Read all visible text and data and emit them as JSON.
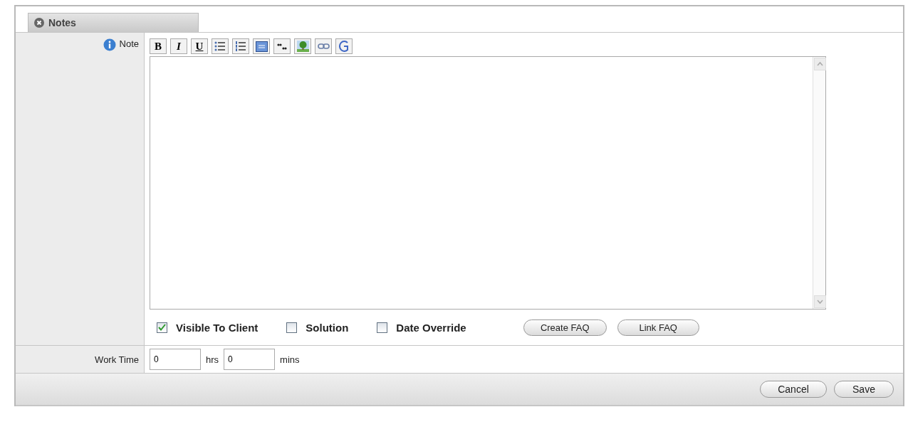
{
  "tab": {
    "title": "Notes"
  },
  "note": {
    "label": "Note",
    "toolbar": [
      {
        "kind": "bold",
        "label": "B"
      },
      {
        "kind": "italic",
        "label": "I"
      },
      {
        "kind": "underline",
        "label": "U"
      },
      {
        "kind": "bullets"
      },
      {
        "kind": "numbers"
      },
      {
        "kind": "block"
      },
      {
        "kind": "quote"
      },
      {
        "kind": "image"
      },
      {
        "kind": "link"
      },
      {
        "kind": "google"
      }
    ],
    "options": [
      {
        "label": "Visible To Client",
        "checked": true
      },
      {
        "label": "Solution",
        "checked": false
      },
      {
        "label": "Date Override",
        "checked": false
      }
    ],
    "buttons": [
      "Create FAQ",
      "Link FAQ"
    ]
  },
  "work_time": {
    "label": "Work Time",
    "hours": "0",
    "hours_unit": "hrs",
    "minutes": "0",
    "minutes_unit": "mins"
  },
  "footer_buttons": [
    "Cancel",
    "Save"
  ]
}
